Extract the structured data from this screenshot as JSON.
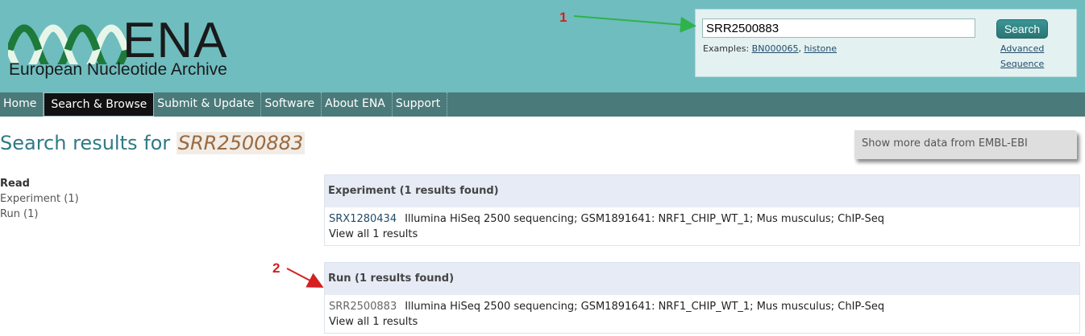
{
  "logo": {
    "title": "ENA",
    "subtitle": "European Nucleotide Archive"
  },
  "search": {
    "value": "SRR2500883",
    "button_label": "Search",
    "examples_label": "Examples:",
    "example_1": "BN000065",
    "example_sep": ",",
    "example_2": "histone",
    "advanced_label": "Advanced",
    "sequence_label": "Sequence"
  },
  "nav": {
    "items": [
      {
        "label": "Home"
      },
      {
        "label": "Search & Browse"
      },
      {
        "label": "Submit & Update"
      },
      {
        "label": "Software"
      },
      {
        "label": "About ENA"
      },
      {
        "label": "Support"
      }
    ],
    "active_index": 1
  },
  "results": {
    "title_prefix": "Search results for",
    "query": "SRR2500883",
    "more_data_label": "Show more data from EMBL-EBI"
  },
  "facets": {
    "title": "Read",
    "items": [
      {
        "label": "Experiment (1)"
      },
      {
        "label": "Run (1)"
      }
    ]
  },
  "panels": [
    {
      "heading": "Experiment (1 results found)",
      "accession": "SRX1280434",
      "description": "Illumina HiSeq 2500 sequencing; GSM1891641: NRF1_CHIP_WT_1; Mus musculus; ChIP-Seq",
      "view_all": "View all 1 results"
    },
    {
      "heading": "Run (1 results found)",
      "accession": "SRR2500883",
      "description": "Illumina HiSeq 2500 sequencing; GSM1891641: NRF1_CHIP_WT_1; Mus musculus; ChIP-Seq",
      "view_all": "View all 1 results"
    }
  ],
  "annotations": {
    "label_1": "1",
    "label_2": "2"
  },
  "colors": {
    "header_bg": "#6fbdbf",
    "nav_bg": "#4b7a7a",
    "title_color": "#2f7a83",
    "arrow_green": "#2db34a",
    "arrow_red": "#d42020"
  }
}
